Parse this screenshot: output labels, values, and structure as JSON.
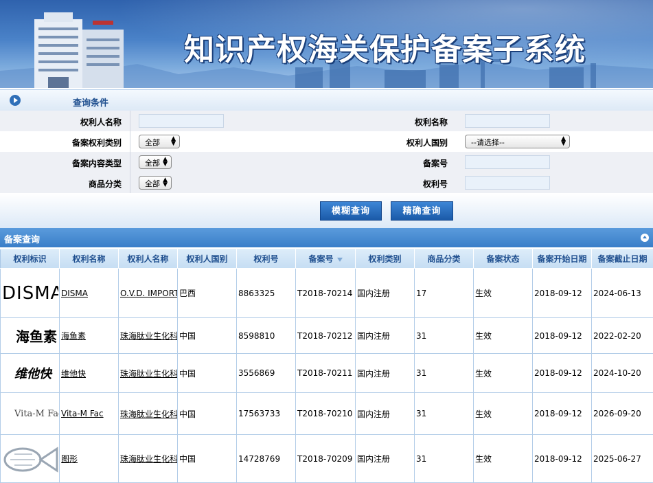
{
  "header": {
    "title": "知识产权海关保护备案子系统"
  },
  "query": {
    "section_title": "查询条件",
    "owner_name_label": "权利人名称",
    "right_name_label": "权利名称",
    "right_category_label": "备案权利类别",
    "right_category_value": "全部",
    "owner_country_label": "权利人国别",
    "owner_country_value": "--请选择--",
    "content_type_label": "备案内容类型",
    "content_type_value": "全部",
    "record_no_label": "备案号",
    "goods_class_label": "商品分类",
    "goods_class_value": "全部",
    "right_no_label": "权利号",
    "fuzzy_button": "模糊查询",
    "exact_button": "精确查询"
  },
  "results": {
    "section_title": "备案查询",
    "columns": [
      "权利标识",
      "权利名称",
      "权利人名称",
      "权利人国别",
      "权利号",
      "备案号",
      "权利类别",
      "商品分类",
      "备案状态",
      "备案开始日期",
      "备案截止日期"
    ],
    "rows": [
      {
        "logo": "DISMA",
        "name": "DISMA",
        "owner": "O.V.D. IMPORT",
        "country": "巴西",
        "right_no": "8863325",
        "record_no": "T2018-70214",
        "type": "国内注册",
        "goods": "17",
        "status": "生效",
        "start": "2018-09-12",
        "end": "2024-06-13"
      },
      {
        "logo": "海鱼素",
        "name": "海鱼素",
        "owner": "珠海肽业生化科",
        "country": "中国",
        "right_no": "8598810",
        "record_no": "T2018-70212",
        "type": "国内注册",
        "goods": "31",
        "status": "生效",
        "start": "2018-09-12",
        "end": "2022-02-20"
      },
      {
        "logo": "维他快",
        "name": "维他快",
        "owner": "珠海肽业生化科",
        "country": "中国",
        "right_no": "3556869",
        "record_no": "T2018-70211",
        "type": "国内注册",
        "goods": "31",
        "status": "生效",
        "start": "2018-09-12",
        "end": "2024-10-20"
      },
      {
        "logo": "Vita-M Fac",
        "name": "Vita-M Fac",
        "owner": "珠海肽业生化科",
        "country": "中国",
        "right_no": "17563733",
        "record_no": "T2018-70210",
        "type": "国内注册",
        "goods": "31",
        "status": "生效",
        "start": "2018-09-12",
        "end": "2026-09-20"
      },
      {
        "logo": "",
        "name": "图形",
        "owner": "珠海肽业生化科",
        "country": "中国",
        "right_no": "14728769",
        "record_no": "T2018-70209",
        "type": "国内注册",
        "goods": "31",
        "status": "生效",
        "start": "2018-09-12",
        "end": "2025-06-27"
      }
    ]
  },
  "icons": {
    "section": "play-icon",
    "collapse": "collapse-icon",
    "sort": "sort-desc-icon"
  }
}
